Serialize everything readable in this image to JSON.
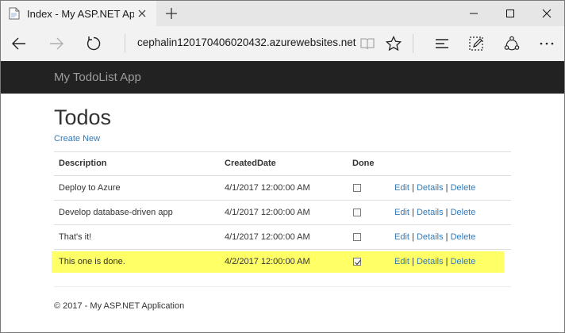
{
  "browser": {
    "tab_title": "Index - My ASP.NET App",
    "url": "cephalin120170406020432.azurewebsites.net",
    "icons": {
      "favicon": "page-icon",
      "close": "close-icon",
      "new_tab": "plus-icon",
      "back": "arrow-left-icon",
      "forward": "arrow-right-icon",
      "refresh": "refresh-icon",
      "reading": "book-icon",
      "favorite": "star-icon",
      "hub": "hub-icon",
      "notes": "pen-icon",
      "share": "share-icon",
      "more": "more-icon"
    }
  },
  "app": {
    "brand": "My TodoList App",
    "title": "Todos",
    "create_new": "Create New",
    "columns": {
      "description": "Description",
      "created": "CreatedDate",
      "done": "Done"
    },
    "actions": {
      "edit": "Edit",
      "details": "Details",
      "delete": "Delete",
      "separator": "|"
    },
    "rows": [
      {
        "description": "Deploy to Azure",
        "created": "4/1/2017 12:00:00 AM",
        "done": false
      },
      {
        "description": "Develop database-driven app",
        "created": "4/1/2017 12:00:00 AM",
        "done": false
      },
      {
        "description": "That's it!",
        "created": "4/1/2017 12:00:00 AM",
        "done": false
      },
      {
        "description": "This one is done.",
        "created": "4/2/2017 12:00:00 AM",
        "done": true
      }
    ],
    "highlight_color": "#ffff66",
    "footer": "© 2017 - My ASP.NET Application"
  }
}
